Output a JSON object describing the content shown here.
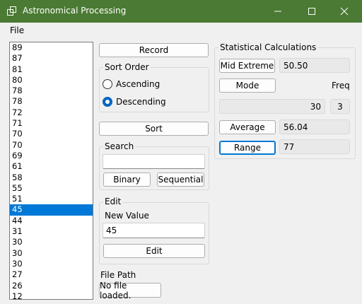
{
  "window": {
    "title": "Astronomical Processing",
    "accent": "#4a7a33"
  },
  "menu": {
    "file": "File"
  },
  "list": {
    "items": [
      "89",
      "87",
      "81",
      "80",
      "78",
      "78",
      "72",
      "71",
      "70",
      "70",
      "69",
      "61",
      "58",
      "55",
      "51",
      "45",
      "44",
      "31",
      "30",
      "30",
      "30",
      "27",
      "26",
      "12"
    ],
    "selected_index": 15
  },
  "buttons": {
    "record": "Record",
    "sort": "Sort",
    "binary": "Binary",
    "sequential": "Sequential",
    "edit": "Edit"
  },
  "sort_order": {
    "title": "Sort Order",
    "ascending": "Ascending",
    "descending": "Descending",
    "selected": "Descending"
  },
  "search": {
    "title": "Search",
    "value": ""
  },
  "edit": {
    "title": "Edit",
    "new_value_label": "New Value",
    "value": "45"
  },
  "file_path": {
    "label": "File Path",
    "status": "No file loaded."
  },
  "stats": {
    "title": "Statistical Calculations",
    "mid_extreme_button": "Mid Extreme",
    "mid_extreme_value": "50.50",
    "mode_button": "Mode",
    "freq_label": "Freq",
    "mode_value": "30",
    "freq_value": "3",
    "average_button": "Average",
    "average_value": "56.04",
    "range_button": "Range",
    "range_value": "77"
  }
}
